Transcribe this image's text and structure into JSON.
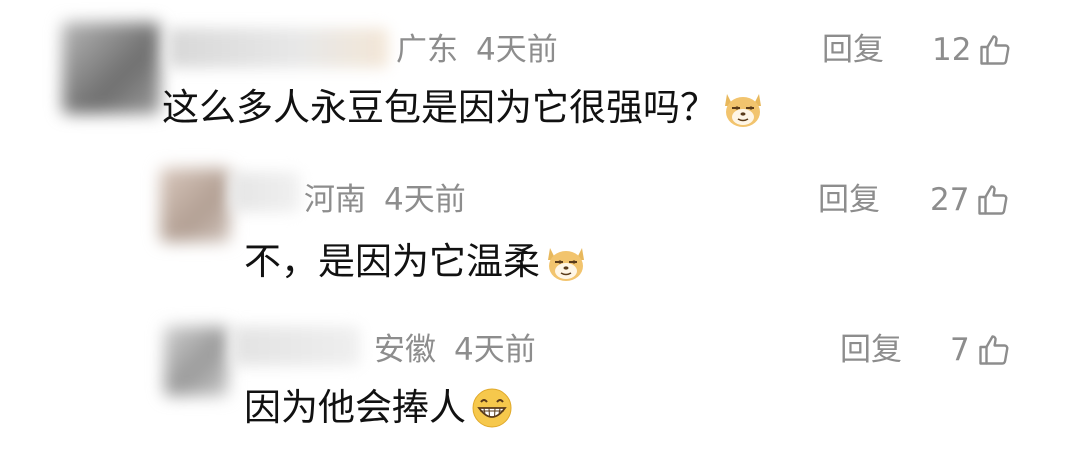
{
  "comments": [
    {
      "region": "广东",
      "time": "4天前",
      "reply_label": "回复",
      "likes": "12",
      "text": "这么多人永豆包是因为它很强吗？",
      "emoji": "smirking-doge-emoji"
    },
    {
      "region": "河南",
      "time": "4天前",
      "reply_label": "回复",
      "likes": "27",
      "text": "不，是因为它温柔",
      "emoji": "smirking-doge-emoji"
    },
    {
      "region": "安徽",
      "time": "4天前",
      "reply_label": "回复",
      "likes": "7",
      "text": "因为他会捧人",
      "emoji": "grinning-face-emoji"
    }
  ],
  "colors": {
    "meta": "#8d8d8d",
    "text": "#111111",
    "background": "#ffffff"
  },
  "icons": {
    "like": "thumbs-up-outline-icon"
  }
}
